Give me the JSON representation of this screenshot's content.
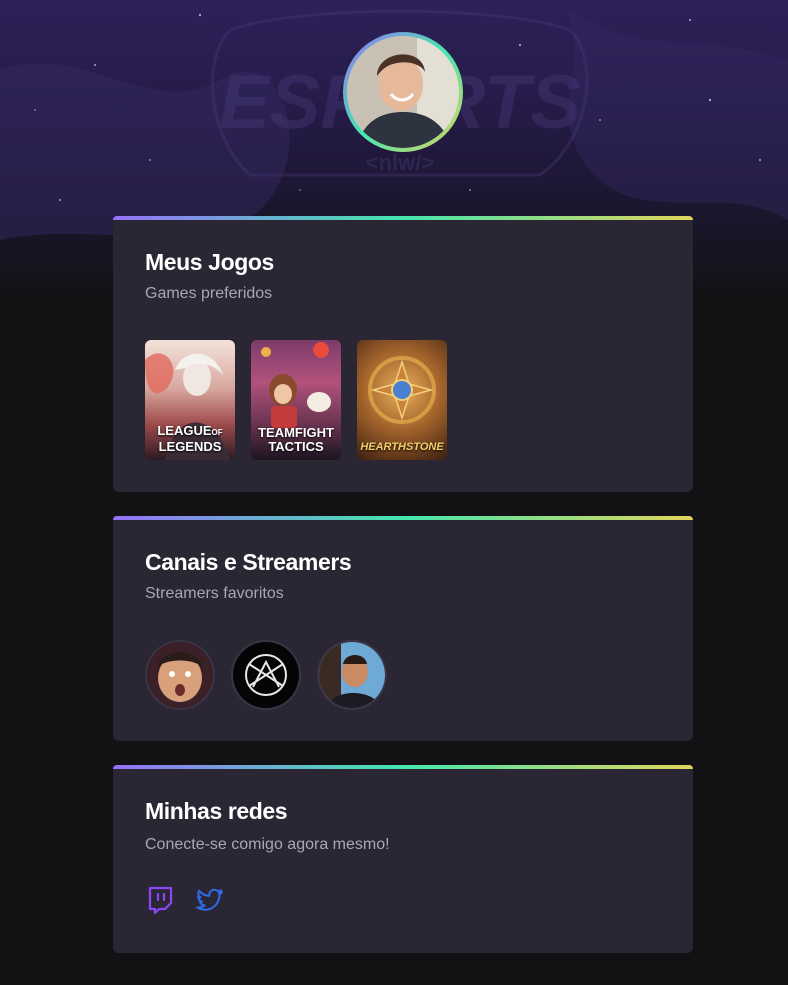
{
  "hero": {
    "logo_text": "ESPORTS",
    "logo_sub": "<nlw/>"
  },
  "profile": {
    "avatar": "profile-photo"
  },
  "games_card": {
    "title": "Meus Jogos",
    "subtitle": "Games preferidos",
    "games": [
      {
        "line1": "LEAGUE",
        "line2": "LEGENDS",
        "small": "OF"
      },
      {
        "line1": "TEAMFIGHT",
        "line2": "TACTICS"
      },
      {
        "line1": "HEARTHSTONE"
      }
    ]
  },
  "streamers_card": {
    "title": "Canais e Streamers",
    "subtitle": "Streamers favoritos",
    "streamers": [
      {
        "avatar": "streamer-1"
      },
      {
        "avatar": "streamer-2-logo"
      },
      {
        "avatar": "streamer-3"
      }
    ]
  },
  "social_card": {
    "title": "Minhas redes",
    "subtitle": "Conecte-se comigo agora mesmo!",
    "links": [
      {
        "icon": "twitch-icon",
        "color": "#8b47f5"
      },
      {
        "icon": "twitter-icon",
        "color": "#2d6be8"
      }
    ]
  },
  "colors": {
    "background": "#121214",
    "card": "#2a2634",
    "gradient": [
      "#9572fc",
      "#43e7ad",
      "#e2d45c"
    ]
  }
}
